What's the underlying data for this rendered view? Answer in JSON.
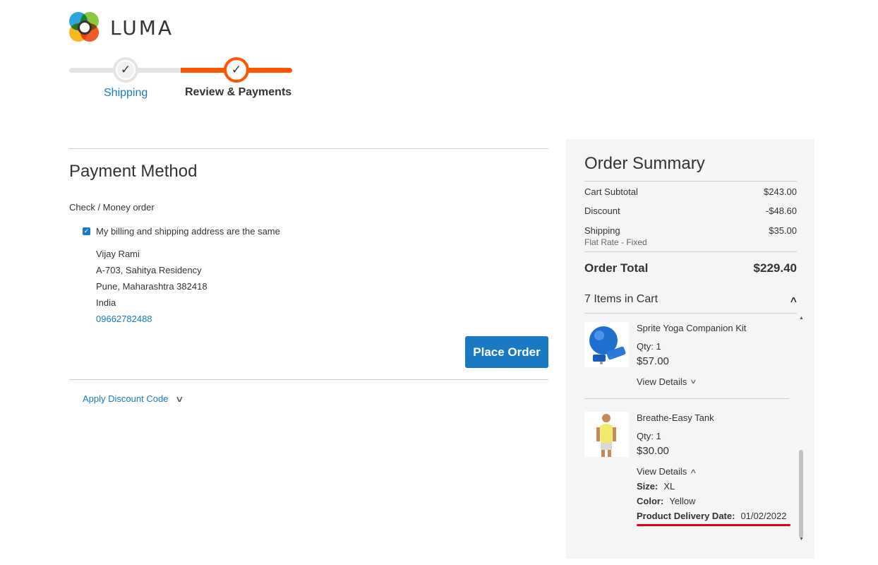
{
  "brand": {
    "name": "LUMA"
  },
  "progress": {
    "steps": [
      {
        "label": "Shipping",
        "status": "complete"
      },
      {
        "label": "Review & Payments",
        "status": "active"
      }
    ]
  },
  "payment": {
    "title": "Payment Method",
    "method": "Check / Money order",
    "same_address_label": "My billing and shipping address are the same",
    "same_address_checked": true,
    "address": {
      "name": "Vijay Rami",
      "street": "A-703, Sahitya Residency",
      "city_line": "Pune, Maharashtra 382418",
      "country": "India",
      "phone": "09662782488"
    },
    "place_order_label": "Place Order",
    "discount_label": "Apply Discount Code"
  },
  "summary": {
    "title": "Order Summary",
    "cart_subtotal_label": "Cart Subtotal",
    "cart_subtotal": "$243.00",
    "discount_label": "Discount",
    "discount": "-$48.60",
    "shipping_label": "Shipping",
    "shipping": "$35.00",
    "shipping_method": "Flat Rate - Fixed",
    "order_total_label": "Order Total",
    "order_total": "$229.40",
    "items_in_cart": "7 Items in Cart",
    "items": [
      {
        "name": "Sprite Yoga Companion Kit",
        "qty": "Qty: 1",
        "price": "$57.00",
        "view_details": "View Details"
      },
      {
        "name": "Breathe-Easy Tank",
        "qty": "Qty: 1",
        "price": "$30.00",
        "view_details": "View Details",
        "options": [
          {
            "label": "Size:",
            "value": "XL"
          },
          {
            "label": "Color:",
            "value": "Yellow"
          },
          {
            "label": "Product Delivery Date:",
            "value": "01/02/2022"
          }
        ]
      }
    ]
  },
  "colors": {
    "accent": "#1979c3",
    "progress_active": "#ff5501",
    "annotation": "#e3001b"
  }
}
